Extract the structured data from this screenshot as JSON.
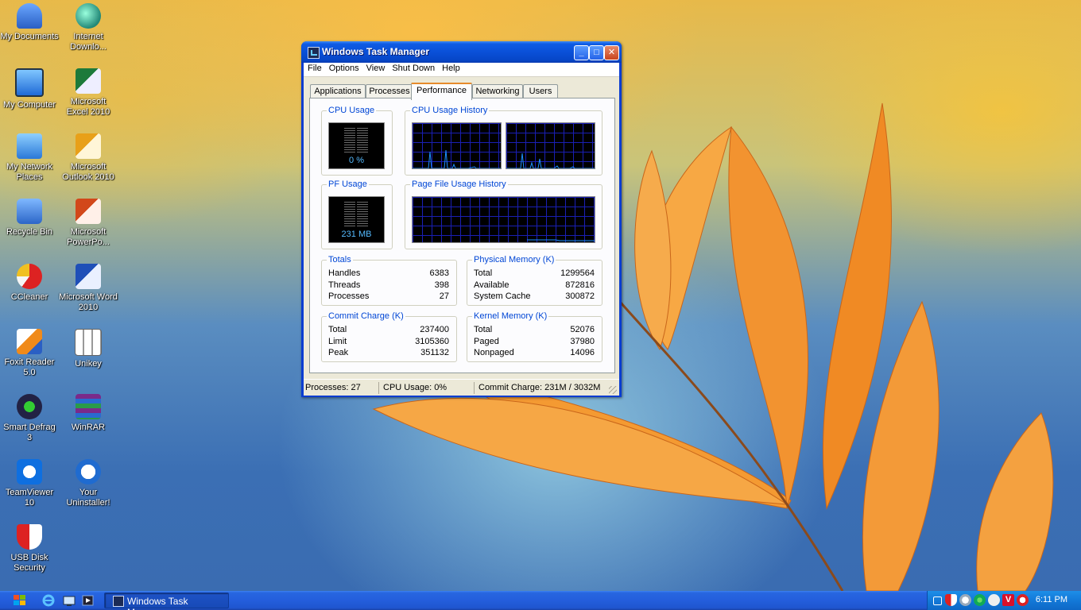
{
  "desktop": {
    "icons": [
      {
        "label": "My Documents",
        "icon": "user-folder-icon"
      },
      {
        "label": "Internet Downlo...",
        "icon": "globe-download-icon"
      },
      {
        "label": "My Computer",
        "icon": "monitor-icon"
      },
      {
        "label": "Microsoft Excel 2010",
        "icon": "excel-icon"
      },
      {
        "label": "My Network Places",
        "icon": "network-icon"
      },
      {
        "label": "Microsoft Outlook 2010",
        "icon": "outlook-icon"
      },
      {
        "label": "Recycle Bin",
        "icon": "recycle-bin-icon"
      },
      {
        "label": "Microsoft PowerPo...",
        "icon": "powerpoint-icon"
      },
      {
        "label": "CCleaner",
        "icon": "ccleaner-icon"
      },
      {
        "label": "Microsoft Word 2010",
        "icon": "word-icon"
      },
      {
        "label": "Foxit Reader 5.0",
        "icon": "foxit-icon"
      },
      {
        "label": "Unikey",
        "icon": "unikey-icon"
      },
      {
        "label": "Smart Defrag 3",
        "icon": "defrag-icon"
      },
      {
        "label": "WinRAR",
        "icon": "winrar-icon"
      },
      {
        "label": "TeamViewer 10",
        "icon": "teamviewer-icon"
      },
      {
        "label": "Your Uninstaller!",
        "icon": "uninstaller-icon"
      },
      {
        "label": "USB Disk Security",
        "icon": "shield-icon"
      }
    ]
  },
  "window": {
    "title": "Windows Task Manager",
    "buttons": {
      "minimize": "_",
      "maximize": "□",
      "close": "✕"
    },
    "menu": [
      "File",
      "Options",
      "View",
      "Shut Down",
      "Help"
    ],
    "tabs": [
      "Applications",
      "Processes",
      "Performance",
      "Networking",
      "Users"
    ],
    "active_tab": "Performance",
    "cpu_usage": {
      "title": "CPU Usage",
      "value": "0 %"
    },
    "cpu_history": {
      "title": "CPU Usage History"
    },
    "pf_usage": {
      "title": "PF Usage",
      "value": "231 MB"
    },
    "pf_history": {
      "title": "Page File Usage History"
    },
    "totals": {
      "title": "Totals",
      "rows": [
        {
          "k": "Handles",
          "v": "6383"
        },
        {
          "k": "Threads",
          "v": "398"
        },
        {
          "k": "Processes",
          "v": "27"
        }
      ]
    },
    "physical": {
      "title": "Physical Memory (K)",
      "rows": [
        {
          "k": "Total",
          "v": "1299564"
        },
        {
          "k": "Available",
          "v": "872816"
        },
        {
          "k": "System Cache",
          "v": "300872"
        }
      ]
    },
    "commit": {
      "title": "Commit Charge (K)",
      "rows": [
        {
          "k": "Total",
          "v": "237400"
        },
        {
          "k": "Limit",
          "v": "3105360"
        },
        {
          "k": "Peak",
          "v": "351132"
        }
      ]
    },
    "kernel": {
      "title": "Kernel Memory (K)",
      "rows": [
        {
          "k": "Total",
          "v": "52076"
        },
        {
          "k": "Paged",
          "v": "37980"
        },
        {
          "k": "Nonpaged",
          "v": "14096"
        }
      ]
    },
    "status": {
      "processes": "Processes: 27",
      "cpu": "CPU Usage: 0%",
      "commit": "Commit Charge: 231M / 3032M"
    }
  },
  "taskbar": {
    "task_label": "Windows Task Manager",
    "clock": "6:11 PM"
  },
  "colors": {
    "xp_title_blue": "#0a50d8",
    "group_title": "#0046d5",
    "graph_line": "#1e90ff",
    "meter_text": "#55bbff"
  }
}
